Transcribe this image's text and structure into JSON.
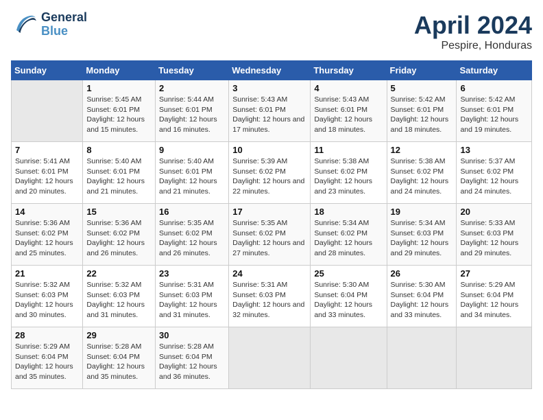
{
  "header": {
    "logo_general": "General",
    "logo_blue": "Blue",
    "month": "April 2024",
    "location": "Pespire, Honduras"
  },
  "columns": [
    "Sunday",
    "Monday",
    "Tuesday",
    "Wednesday",
    "Thursday",
    "Friday",
    "Saturday"
  ],
  "weeks": [
    [
      {
        "day": "",
        "empty": true
      },
      {
        "day": "1",
        "sunrise": "Sunrise: 5:45 AM",
        "sunset": "Sunset: 6:01 PM",
        "daylight": "Daylight: 12 hours and 15 minutes."
      },
      {
        "day": "2",
        "sunrise": "Sunrise: 5:44 AM",
        "sunset": "Sunset: 6:01 PM",
        "daylight": "Daylight: 12 hours and 16 minutes."
      },
      {
        "day": "3",
        "sunrise": "Sunrise: 5:43 AM",
        "sunset": "Sunset: 6:01 PM",
        "daylight": "Daylight: 12 hours and 17 minutes."
      },
      {
        "day": "4",
        "sunrise": "Sunrise: 5:43 AM",
        "sunset": "Sunset: 6:01 PM",
        "daylight": "Daylight: 12 hours and 18 minutes."
      },
      {
        "day": "5",
        "sunrise": "Sunrise: 5:42 AM",
        "sunset": "Sunset: 6:01 PM",
        "daylight": "Daylight: 12 hours and 18 minutes."
      },
      {
        "day": "6",
        "sunrise": "Sunrise: 5:42 AM",
        "sunset": "Sunset: 6:01 PM",
        "daylight": "Daylight: 12 hours and 19 minutes."
      }
    ],
    [
      {
        "day": "7",
        "sunrise": "Sunrise: 5:41 AM",
        "sunset": "Sunset: 6:01 PM",
        "daylight": "Daylight: 12 hours and 20 minutes."
      },
      {
        "day": "8",
        "sunrise": "Sunrise: 5:40 AM",
        "sunset": "Sunset: 6:01 PM",
        "daylight": "Daylight: 12 hours and 21 minutes."
      },
      {
        "day": "9",
        "sunrise": "Sunrise: 5:40 AM",
        "sunset": "Sunset: 6:01 PM",
        "daylight": "Daylight: 12 hours and 21 minutes."
      },
      {
        "day": "10",
        "sunrise": "Sunrise: 5:39 AM",
        "sunset": "Sunset: 6:02 PM",
        "daylight": "Daylight: 12 hours and 22 minutes."
      },
      {
        "day": "11",
        "sunrise": "Sunrise: 5:38 AM",
        "sunset": "Sunset: 6:02 PM",
        "daylight": "Daylight: 12 hours and 23 minutes."
      },
      {
        "day": "12",
        "sunrise": "Sunrise: 5:38 AM",
        "sunset": "Sunset: 6:02 PM",
        "daylight": "Daylight: 12 hours and 24 minutes."
      },
      {
        "day": "13",
        "sunrise": "Sunrise: 5:37 AM",
        "sunset": "Sunset: 6:02 PM",
        "daylight": "Daylight: 12 hours and 24 minutes."
      }
    ],
    [
      {
        "day": "14",
        "sunrise": "Sunrise: 5:36 AM",
        "sunset": "Sunset: 6:02 PM",
        "daylight": "Daylight: 12 hours and 25 minutes."
      },
      {
        "day": "15",
        "sunrise": "Sunrise: 5:36 AM",
        "sunset": "Sunset: 6:02 PM",
        "daylight": "Daylight: 12 hours and 26 minutes."
      },
      {
        "day": "16",
        "sunrise": "Sunrise: 5:35 AM",
        "sunset": "Sunset: 6:02 PM",
        "daylight": "Daylight: 12 hours and 26 minutes."
      },
      {
        "day": "17",
        "sunrise": "Sunrise: 5:35 AM",
        "sunset": "Sunset: 6:02 PM",
        "daylight": "Daylight: 12 hours and 27 minutes."
      },
      {
        "day": "18",
        "sunrise": "Sunrise: 5:34 AM",
        "sunset": "Sunset: 6:02 PM",
        "daylight": "Daylight: 12 hours and 28 minutes."
      },
      {
        "day": "19",
        "sunrise": "Sunrise: 5:34 AM",
        "sunset": "Sunset: 6:03 PM",
        "daylight": "Daylight: 12 hours and 29 minutes."
      },
      {
        "day": "20",
        "sunrise": "Sunrise: 5:33 AM",
        "sunset": "Sunset: 6:03 PM",
        "daylight": "Daylight: 12 hours and 29 minutes."
      }
    ],
    [
      {
        "day": "21",
        "sunrise": "Sunrise: 5:32 AM",
        "sunset": "Sunset: 6:03 PM",
        "daylight": "Daylight: 12 hours and 30 minutes."
      },
      {
        "day": "22",
        "sunrise": "Sunrise: 5:32 AM",
        "sunset": "Sunset: 6:03 PM",
        "daylight": "Daylight: 12 hours and 31 minutes."
      },
      {
        "day": "23",
        "sunrise": "Sunrise: 5:31 AM",
        "sunset": "Sunset: 6:03 PM",
        "daylight": "Daylight: 12 hours and 31 minutes."
      },
      {
        "day": "24",
        "sunrise": "Sunrise: 5:31 AM",
        "sunset": "Sunset: 6:03 PM",
        "daylight": "Daylight: 12 hours and 32 minutes."
      },
      {
        "day": "25",
        "sunrise": "Sunrise: 5:30 AM",
        "sunset": "Sunset: 6:04 PM",
        "daylight": "Daylight: 12 hours and 33 minutes."
      },
      {
        "day": "26",
        "sunrise": "Sunrise: 5:30 AM",
        "sunset": "Sunset: 6:04 PM",
        "daylight": "Daylight: 12 hours and 33 minutes."
      },
      {
        "day": "27",
        "sunrise": "Sunrise: 5:29 AM",
        "sunset": "Sunset: 6:04 PM",
        "daylight": "Daylight: 12 hours and 34 minutes."
      }
    ],
    [
      {
        "day": "28",
        "sunrise": "Sunrise: 5:29 AM",
        "sunset": "Sunset: 6:04 PM",
        "daylight": "Daylight: 12 hours and 35 minutes."
      },
      {
        "day": "29",
        "sunrise": "Sunrise: 5:28 AM",
        "sunset": "Sunset: 6:04 PM",
        "daylight": "Daylight: 12 hours and 35 minutes."
      },
      {
        "day": "30",
        "sunrise": "Sunrise: 5:28 AM",
        "sunset": "Sunset: 6:04 PM",
        "daylight": "Daylight: 12 hours and 36 minutes."
      },
      {
        "day": "",
        "empty": true
      },
      {
        "day": "",
        "empty": true
      },
      {
        "day": "",
        "empty": true
      },
      {
        "day": "",
        "empty": true
      }
    ]
  ]
}
